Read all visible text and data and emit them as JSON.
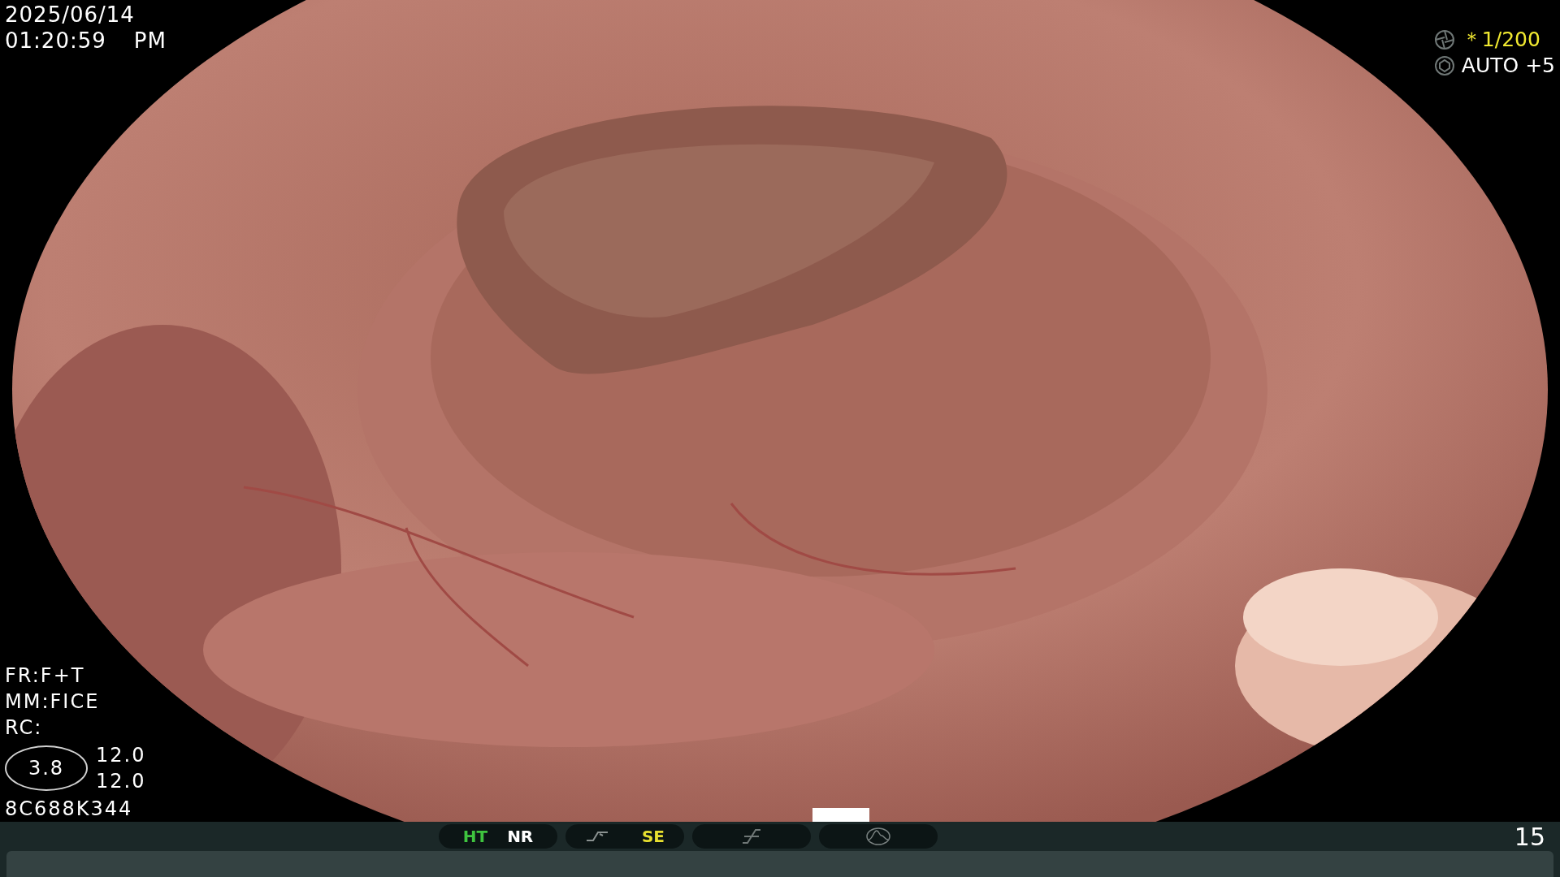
{
  "top_left": {
    "date": "2025/06/14",
    "time": "01:20:59",
    "meridiem": "PM"
  },
  "top_right": {
    "shutter": "＊1/200",
    "iris": "AUTO +5"
  },
  "bottom_left": {
    "lines": [
      "FR:F+T",
      "MM:FICE",
      "RC:"
    ],
    "zoom_badge": "3.8",
    "values": [
      "12.0",
      "12.0"
    ],
    "serial": "8C688K344"
  },
  "status_bar": {
    "groups": [
      {
        "kind": "labels",
        "items": [
          {
            "label": "HT",
            "color": "#3fc43f"
          },
          {
            "label": "NR",
            "color": "#ffffff"
          }
        ]
      },
      {
        "kind": "curve",
        "items": [
          {
            "label": "SE",
            "color": "#e8e030"
          }
        ]
      },
      {
        "kind": "slope"
      },
      {
        "kind": "wave"
      }
    ],
    "counter": "15"
  }
}
